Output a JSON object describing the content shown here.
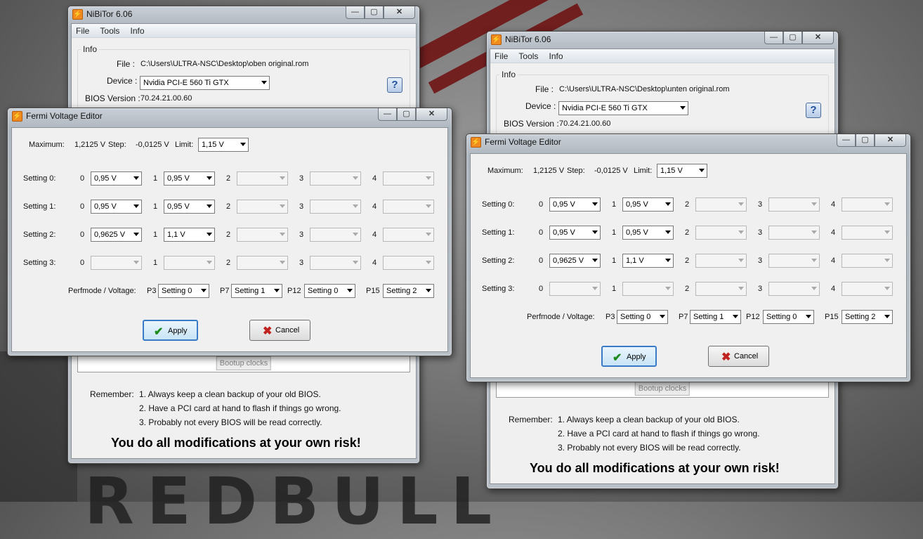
{
  "app": {
    "icon": "nibitor-icon",
    "title": "NiBiTor 6.06",
    "controls": {
      "minimize": "—",
      "maximize": "▢",
      "close": "✕"
    },
    "menu": [
      "File",
      "Tools",
      "Info"
    ],
    "info_legend": "Info",
    "file_label": "File :",
    "device_label": "Device :",
    "device_value": "Nvidia PCI-E 560 Ti GTX",
    "bios_label": "BIOS Version :",
    "bios_value": "70.24.21.00.60",
    "help_label": "?",
    "bootup_label": "Bootup clocks",
    "remember_label": "Remember:",
    "remember_items": [
      "1. Always keep a clean backup of your old BIOS.",
      "2. Have a PCI card at hand to flash if things go wrong.",
      "3. Probably not every BIOS will be read correctly."
    ],
    "risk_text": "You do all modifications at your own risk!"
  },
  "windows": [
    {
      "file_path": "C:\\Users\\ULTRA-NSC\\Desktop\\oben original.rom"
    },
    {
      "file_path": "C:\\Users\\ULTRA-NSC\\Desktop\\unten original.rom"
    }
  ],
  "fermi": {
    "title": "Fermi Voltage Editor",
    "maximum_label": "Maximum:",
    "maximum_value": "1,2125 V",
    "step_label": "Step:",
    "step_value": "-0,0125 V",
    "limit_label": "Limit:",
    "limit_value": "1,15 V",
    "settings": [
      {
        "label": "Setting 0:",
        "values": [
          "0,95 V",
          "0,95 V",
          "",
          "",
          ""
        ]
      },
      {
        "label": "Setting 1:",
        "values": [
          "0,95 V",
          "0,95 V",
          "",
          "",
          ""
        ]
      },
      {
        "label": "Setting 2:",
        "values": [
          "0,9625 V",
          "1,1 V",
          "",
          "",
          ""
        ]
      },
      {
        "label": "Setting 3:",
        "values": [
          "",
          "",
          "",
          "",
          ""
        ]
      }
    ],
    "indexes": [
      "0",
      "1",
      "2",
      "3",
      "4"
    ],
    "perf_label": "Perfmode / Voltage:",
    "perfmodes": [
      {
        "label": "P3",
        "value": "Setting 0"
      },
      {
        "label": "P7",
        "value": "Setting 1"
      },
      {
        "label": "P12",
        "value": "Setting 0"
      },
      {
        "label": "P15",
        "value": "Setting 2"
      }
    ],
    "apply_label": "Apply",
    "cancel_label": "Cancel"
  }
}
